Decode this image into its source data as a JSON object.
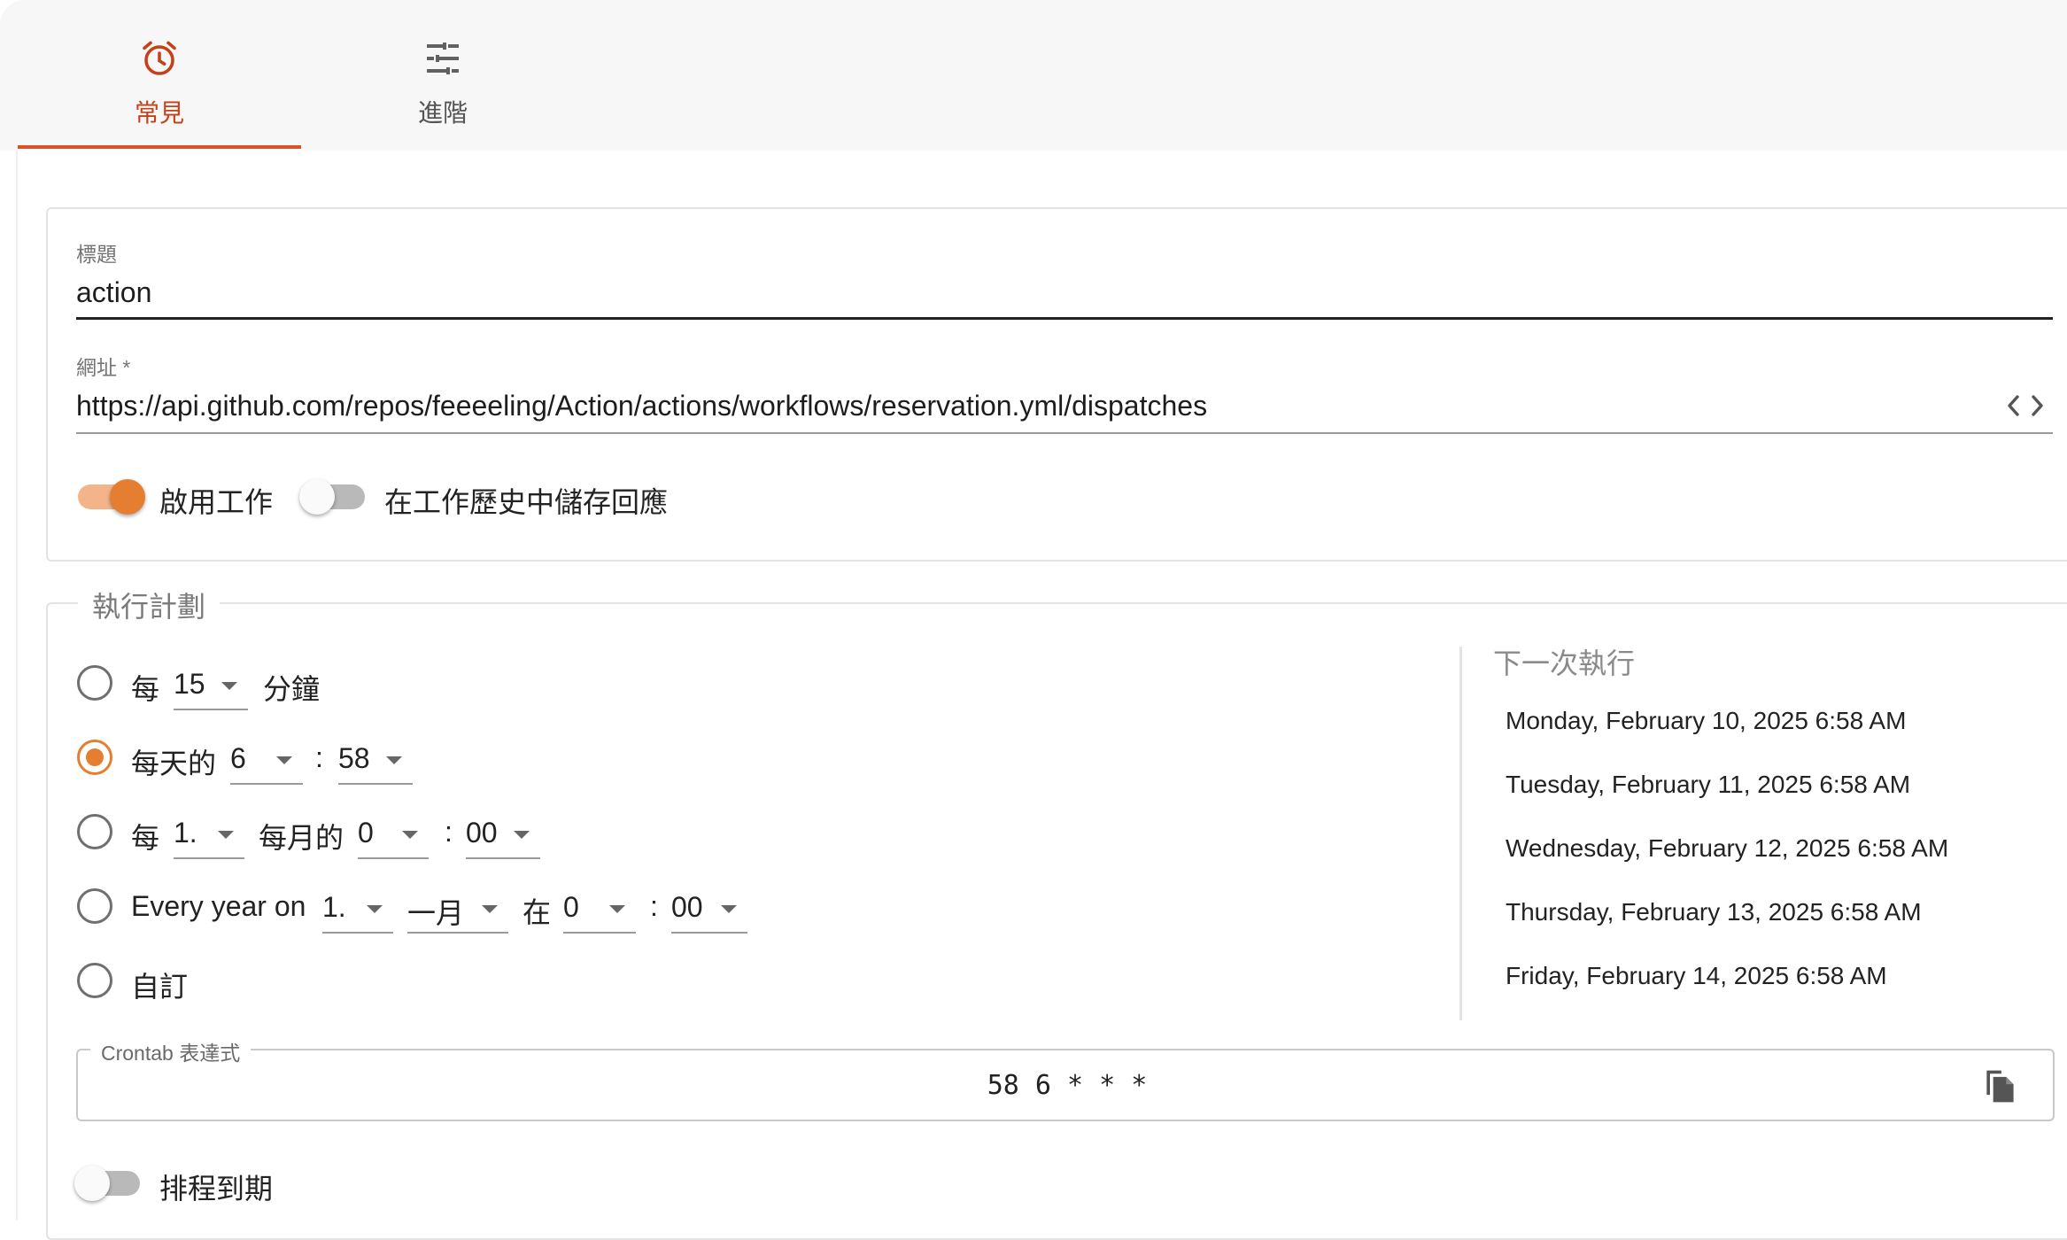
{
  "tabs": [
    {
      "label": "常見",
      "icon": "alarm-clock-icon",
      "active": true
    },
    {
      "label": "進階",
      "icon": "tune-sliders-icon",
      "active": false
    }
  ],
  "form": {
    "title_label": "標題",
    "title_value": "action",
    "url_label": "網址 *",
    "url_value": "https://api.github.com/repos/feeeeling/Action/actions/workflows/reservation.yml/dispatches",
    "url_icon": "code-brackets-icon",
    "enable_label": "啟用工作",
    "enable_on": true,
    "save_label": "在工作歷史中儲存回應",
    "save_on": false
  },
  "schedule": {
    "legend": "執行計劃",
    "options": {
      "every_minutes": {
        "prefix": "每",
        "value": "15",
        "suffix": "分鐘",
        "selected": false
      },
      "daily": {
        "prefix": "每天的",
        "hour": "6",
        "colon": ":",
        "minute": "58",
        "selected": true
      },
      "monthly": {
        "prefix": "每",
        "day": "1.",
        "mid": "每月的",
        "hour": "0",
        "colon": ":",
        "minute": "00",
        "selected": false
      },
      "yearly": {
        "prefix": "Every year on",
        "day": "1.",
        "month": "一月",
        "at": "在",
        "hour": "0",
        "colon": ":",
        "minute": "00",
        "selected": false
      },
      "custom": {
        "label": "自訂",
        "selected": false
      }
    },
    "next_title": "下一次執行",
    "next_runs": [
      "Monday, February 10, 2025 6:58 AM",
      "Tuesday, February 11, 2025 6:58 AM",
      "Wednesday, February 12, 2025 6:58 AM",
      "Thursday, February 13, 2025 6:58 AM",
      "Friday, February 14, 2025 6:58 AM"
    ],
    "crontab_label": "Crontab 表達式",
    "crontab_value": "58 6 * * *",
    "copy_icon": "copy-icon",
    "expire_label": "排程到期",
    "expire_on": false
  },
  "colors": {
    "accent": "#e57e31",
    "tab_active": "#c4421a"
  }
}
